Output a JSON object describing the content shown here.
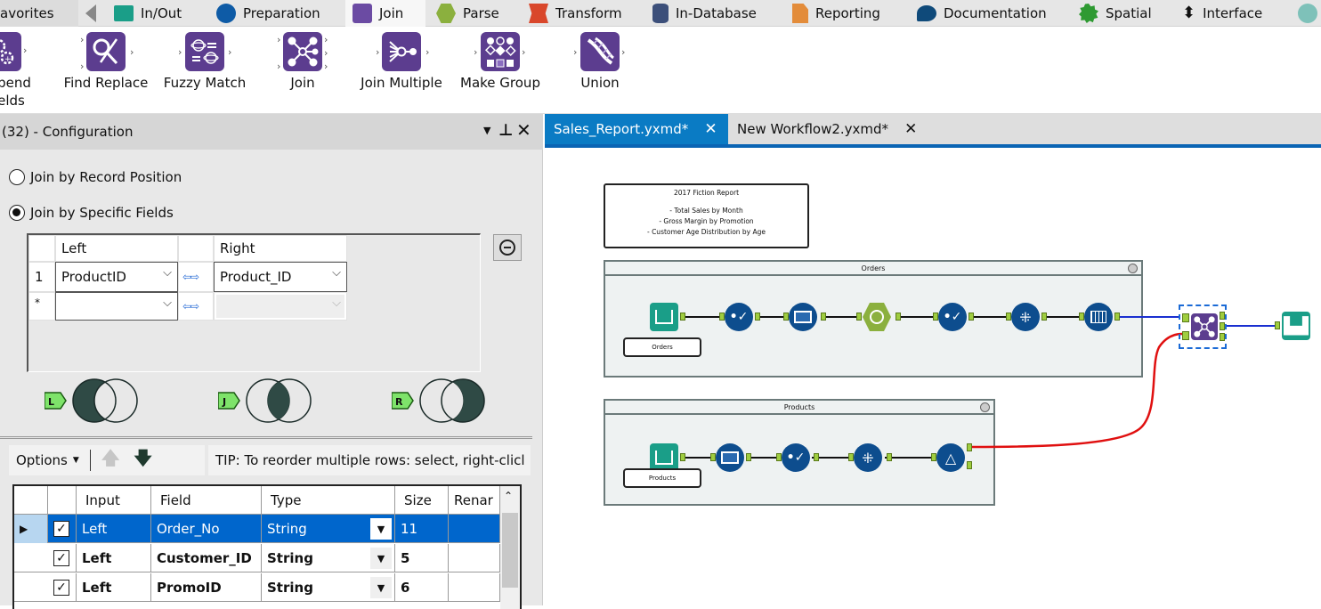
{
  "category_tabs": [
    {
      "label": "avorites",
      "icon": "favorites-icon"
    },
    {
      "label": "In/Out",
      "icon": "folder-icon",
      "color": "#1a9e88"
    },
    {
      "label": "Preparation",
      "icon": "circle-icon",
      "color": "#0e5ba6"
    },
    {
      "label": "Join",
      "icon": "square-icon",
      "color": "#6b4ba3",
      "active": true
    },
    {
      "label": "Parse",
      "icon": "hexagon-icon",
      "color": "#8bb03e"
    },
    {
      "label": "Transform",
      "icon": "ribbon-icon",
      "color": "#d9472b"
    },
    {
      "label": "In-Database",
      "icon": "database-icon",
      "color": "#3c4f7a"
    },
    {
      "label": "Reporting",
      "icon": "document-icon",
      "color": "#e38c3a"
    },
    {
      "label": "Documentation",
      "icon": "speech-bubble-icon",
      "color": "#0f4a7a"
    },
    {
      "label": "Spatial",
      "icon": "gear-star-icon",
      "color": "#2e9a32"
    },
    {
      "label": "Interface",
      "icon": "up-down-arrow-icon",
      "color": "#111111"
    }
  ],
  "tools": [
    {
      "label": "pend\nelds",
      "icon": "append-fields-icon"
    },
    {
      "label": "Find Replace",
      "icon": "find-replace-icon"
    },
    {
      "label": "Fuzzy Match",
      "icon": "fuzzy-match-icon"
    },
    {
      "label": "Join",
      "icon": "join-icon"
    },
    {
      "label": "Join Multiple",
      "icon": "join-multiple-icon"
    },
    {
      "label": "Make Group",
      "icon": "make-group-icon"
    },
    {
      "label": "Union",
      "icon": "union-icon"
    }
  ],
  "config": {
    "title": "(32) - Configuration",
    "radio_record_position": "Join by Record Position",
    "radio_specific_fields": "Join by Specific Fields",
    "selected_mode": "specific_fields",
    "grid": {
      "col_left": "Left",
      "col_right": "Right",
      "rows": [
        {
          "num": "1",
          "left": "ProductID",
          "right": "Product_ID"
        },
        {
          "num": "*",
          "left": "",
          "right": ""
        }
      ]
    },
    "venn": [
      {
        "badge": "L",
        "name": "left-join"
      },
      {
        "badge": "J",
        "name": "inner-join"
      },
      {
        "badge": "R",
        "name": "right-join"
      }
    ],
    "options_label": "Options",
    "tip": "TIP: To reorder multiple rows: select, right-clicl",
    "table": {
      "headers": [
        "Input",
        "Field",
        "Type",
        "Size",
        "Renar"
      ],
      "rows": [
        {
          "checked": true,
          "input": "Left",
          "field": "Order_No",
          "type": "String",
          "size": "11",
          "selected": true
        },
        {
          "checked": true,
          "input": "Left",
          "field": "Customer_ID",
          "type": "String",
          "size": "5"
        },
        {
          "checked": true,
          "input": "Left",
          "field": "PromoID",
          "type": "String",
          "size": "6"
        }
      ]
    }
  },
  "doc_tabs": [
    {
      "label": "Sales_Report.yxmd*",
      "active": true
    },
    {
      "label": "New Workflow2.yxmd*",
      "active": false
    }
  ],
  "canvas": {
    "comment": {
      "title": "2017 Fiction Report",
      "lines": [
        "- Total Sales by Month",
        "- Gross Margin by Promotion",
        "- Customer Age Distribution by Age"
      ]
    },
    "container_orders": {
      "title": "Orders",
      "input_label": "Orders"
    },
    "container_products": {
      "title": "Products",
      "input_label": "Products"
    },
    "colors": {
      "accent": "#0a64b4",
      "wire_left": "#1a2fd0",
      "wire_right": "#e01010",
      "anchor": "#9fcd3f"
    }
  }
}
